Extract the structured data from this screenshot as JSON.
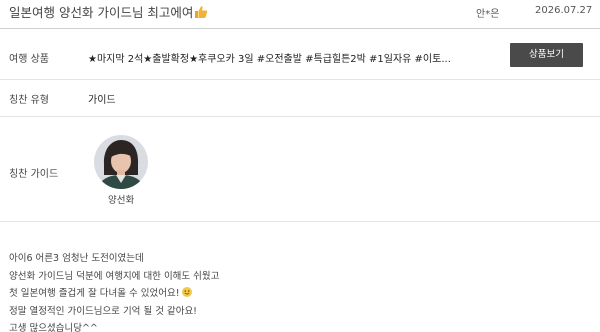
{
  "header": {
    "title": "일본여행 양선화 가이드님 최고에여",
    "title_icon": "thumbs-up-icon",
    "author": "안*은",
    "date": "2026.07.27"
  },
  "details": {
    "product_label": "여행 상품",
    "product_value": "★마지막 2석★출발확정★후쿠오카 3일 #오전출발 #특급힐튼2박 #1일자유 #이토...",
    "product_button": "상품보기",
    "type_label": "칭찬 유형",
    "type_value": "가이드",
    "guide_label": "칭찬 가이드",
    "guide_name": "양선화"
  },
  "review": {
    "lines": [
      "아이6 어른3 엄청난 도전이였는데",
      "양선화 가이드님 덕분에 여행지에 대한 이해도 쉬웠고",
      "첫 일본여행 즐겁게 잘 다녀올 수 있었어요!",
      "정말 열정적인 가이드님으로 기억 될 것 같아요!",
      "고생 많으셨습니당^^"
    ],
    "emoji": "smile-emoji"
  },
  "colors": {
    "button_bg": "#4a4a4a",
    "divider": "#e4e4e4",
    "thumb": "#f2b233"
  }
}
